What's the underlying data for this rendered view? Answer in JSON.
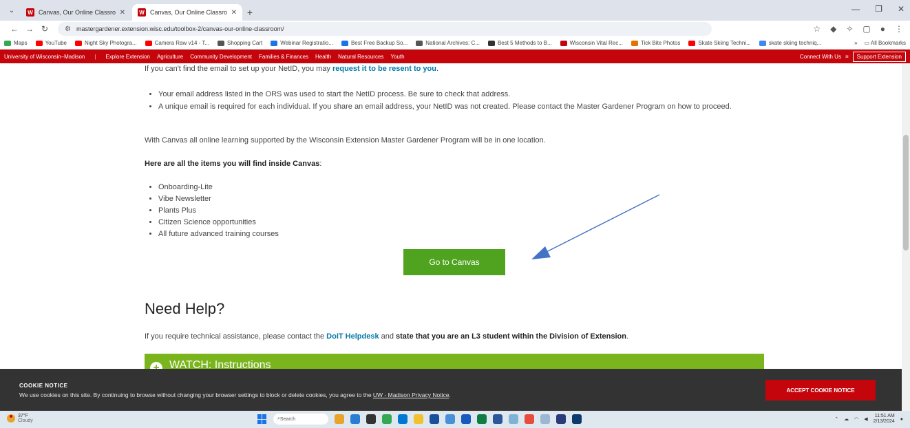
{
  "browser": {
    "tabs": [
      {
        "title": "Canvas, Our Online Classroom",
        "active": false
      },
      {
        "title": "Canvas, Our Online Classroom",
        "active": true
      }
    ],
    "address": "mastergardener.extension.wisc.edu/toolbox-2/canvas-our-online-classroom/",
    "bookmarks": [
      {
        "label": "Maps",
        "color": "#34a853"
      },
      {
        "label": "YouTube",
        "color": "#ff0000"
      },
      {
        "label": "Night Sky Photogra...",
        "color": "#ff0000"
      },
      {
        "label": "Camera Raw v14 - T...",
        "color": "#ff0000"
      },
      {
        "label": "Shopping Cart",
        "color": "#555555"
      },
      {
        "label": "Webinar Registratio...",
        "color": "#1a73e8"
      },
      {
        "label": "Best Free Backup So...",
        "color": "#1a73e8"
      },
      {
        "label": "National Archives: C...",
        "color": "#555555"
      },
      {
        "label": "Best 5 Methods to B...",
        "color": "#333333"
      },
      {
        "label": "Wisconsin Vital Rec...",
        "color": "#c5050c"
      },
      {
        "label": "Tick Bite Photos",
        "color": "#e37400"
      },
      {
        "label": "Skate Skiing Techni...",
        "color": "#ff0000"
      },
      {
        "label": "skate skiing techniq...",
        "color": "#4285f4"
      }
    ],
    "bookmarks_more": "»",
    "all_bookmarks": "All Bookmarks"
  },
  "site_nav": {
    "brand": "University of Wisconsin–Madison",
    "separator": "|",
    "links": [
      "Explore Extension",
      "Agriculture",
      "Community Development",
      "Families & Finances",
      "Health",
      "Natural Resources",
      "Youth"
    ],
    "connect": "Connect With Us",
    "menu_icon": "≡",
    "support": "Support Extension"
  },
  "content": {
    "top_line_text": "If you can't find the email to set up your NetID, you may ",
    "top_line_link": "request it to be resent to you",
    "top_line_end": ".",
    "bullets1": [
      "Your email address listed in the ORS was used to start the NetID process. Be sure to check that address.",
      "A unique email is required for each individual. If you share an email address, your NetID was not created. Please contact the Master Gardener Program on how to proceed."
    ],
    "paragraph": "With Canvas all online learning supported by the Wisconsin Extension Master Gardener Program will be in one location.",
    "here_title": "Here are all the items you will find inside Canvas",
    "here_colon": ":",
    "bullets2": [
      "Onboarding-Lite",
      "Vibe Newsletter",
      "Plants Plus",
      "Citizen Science opportunities",
      "All future advanced training courses"
    ],
    "canvas_button": "Go to Canvas",
    "need_help": "Need Help?",
    "tech_text": "If you require technical assistance, please contact the ",
    "tech_link": "DoIT Helpdesk",
    "tech_and": " and ",
    "tech_bold": "state that you are an L3 student within the Division of Extension",
    "tech_end": ".",
    "watch": "WATCH: Instructions"
  },
  "cookie": {
    "title": "COOKIE NOTICE",
    "text": "We use cookies on this site. By continuing to browse without changing your browser settings to block or delete cookies, you agree to the ",
    "link": "UW - Madison Privacy Notice",
    "end": ".",
    "accept": "ACCEPT COOKIE NOTICE"
  },
  "taskbar": {
    "temp": "37°F",
    "condition": "Cloudy",
    "search": "Search",
    "time": "11:51 AM",
    "date": "2/13/2024"
  },
  "colors": {
    "uw_red": "#c5050c",
    "button_green": "#50a31e",
    "accordion_green": "#7ab51d",
    "arrow_blue": "#4472c4"
  }
}
